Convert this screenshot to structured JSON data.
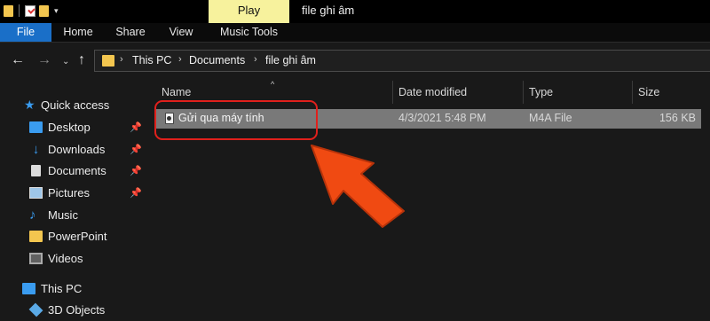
{
  "window": {
    "title": "file ghi âm",
    "context_tab": "Play"
  },
  "quick_access_toolbar": {
    "icons": [
      "folder-icon",
      "properties-icon",
      "new-folder-icon",
      "customize-dropdown-icon"
    ]
  },
  "ribbon": {
    "tabs": [
      "File",
      "Home",
      "Share",
      "View",
      "Music Tools"
    ]
  },
  "navigation": {
    "back_icon": "←",
    "forward_icon": "→",
    "recent_icon": "⌄",
    "up_icon": "↑"
  },
  "address": {
    "crumbs": [
      "This PC",
      "Documents",
      "file ghi âm"
    ],
    "separator": "›"
  },
  "nav_pane": {
    "quick_access_label": "Quick access",
    "items": [
      {
        "label": "Desktop",
        "icon": "desktop-icon",
        "pinned": true
      },
      {
        "label": "Downloads",
        "icon": "downloads-icon",
        "pinned": true
      },
      {
        "label": "Documents",
        "icon": "documents-icon",
        "pinned": true
      },
      {
        "label": "Pictures",
        "icon": "pictures-icon",
        "pinned": true
      },
      {
        "label": "Music",
        "icon": "music-icon",
        "pinned": false
      },
      {
        "label": "PowerPoint",
        "icon": "folder-icon",
        "pinned": false
      },
      {
        "label": "Videos",
        "icon": "videos-icon",
        "pinned": false
      }
    ],
    "this_pc_label": "This PC",
    "objects_label": "3D Objects",
    "pin_glyph": "📌"
  },
  "content": {
    "columns": [
      "Name",
      "Date modified",
      "Type",
      "Size"
    ],
    "sort_indicator": "^",
    "files": [
      {
        "name": "Gửi qua máy tính",
        "date_modified": "4/3/2021 5:48 PM",
        "type": "M4A File",
        "size": "156 KB",
        "selected": true
      }
    ]
  },
  "annotation": {
    "highlight_color": "#e0201c",
    "arrow_color": "#f04a12"
  },
  "colors": {
    "file_tab": "#1a6fc8",
    "context_tab": "#f7f29d",
    "accent": "#3a9cf0",
    "folder": "#f3c64f",
    "selection": "#797979",
    "background": "#191919"
  }
}
